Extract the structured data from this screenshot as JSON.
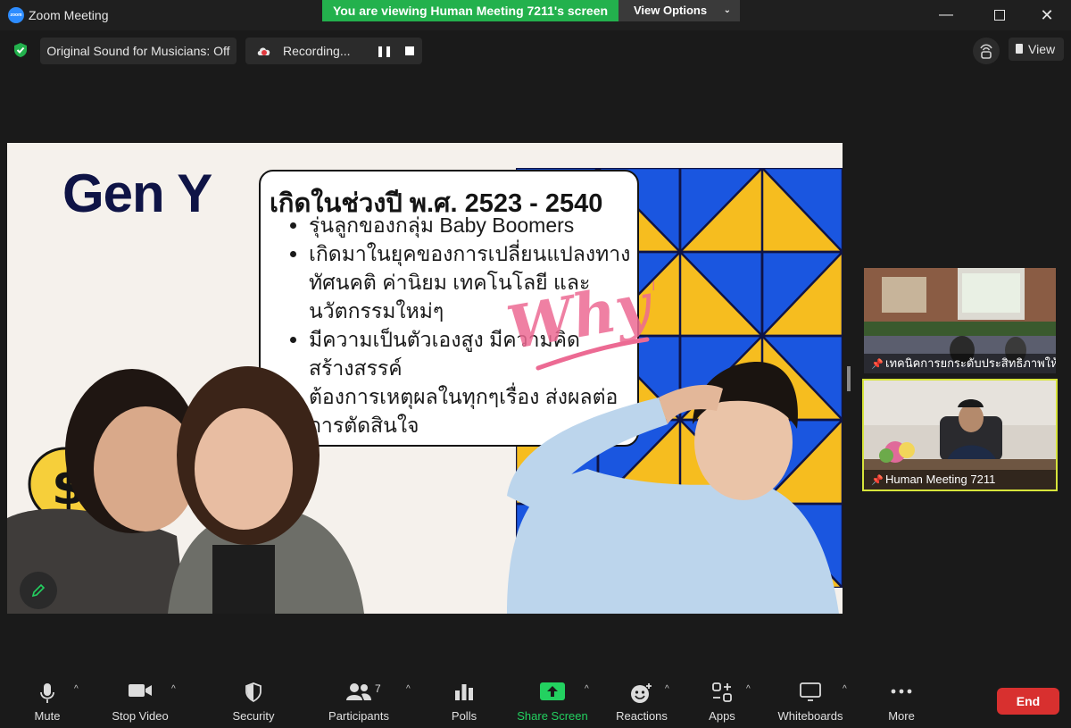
{
  "window": {
    "title": "Zoom Meeting",
    "logo_text": "zoom",
    "minimize": "—",
    "close": "✕"
  },
  "banner": {
    "viewing_text": "You are viewing Human Meeting 7211's screen",
    "view_options_label": "View Options",
    "view_options_chevron": "⌄"
  },
  "topbar": {
    "original_sound_label": "Original Sound for Musicians: Off",
    "recording_label": "Recording...",
    "pause_glyph": "❚❚",
    "view_label": "View"
  },
  "slide": {
    "title": "Gen Y",
    "heading": "เกิดในช่วงปี พ.ศ. 2523 - 2540",
    "bullets": [
      "รุ่นลูกของกลุ่ม Baby Boomers",
      "เกิดมาในยุคของการเปลี่ยนแปลงทางทัศนคติ ค่านิยม เทคโนโลยี และนวัตกรรมใหม่ๆ",
      "มีความเป็นตัวเองสูง มีความคิดสร้างสรรค์",
      "ต้องการเหตุผลในทุกๆเรื่อง ส่งผลต่อการตัดสินใจ"
    ],
    "why_text": "Why?",
    "colors": {
      "blue": "#1a56e0",
      "yellow": "#f6bd1f",
      "navy": "#0f1446",
      "pink": "#ec6a93"
    }
  },
  "thumbnails": [
    {
      "label": "เทคนิคการยกระดับประสิทธิภาพให้..."
    },
    {
      "label": "Human Meeting 7211"
    }
  ],
  "toolbar": {
    "mute": "Mute",
    "stop_video": "Stop Video",
    "security": "Security",
    "participants": "Participants",
    "participants_count": "7",
    "polls": "Polls",
    "share_screen": "Share Screen",
    "reactions": "Reactions",
    "apps": "Apps",
    "whiteboards": "Whiteboards",
    "more": "More",
    "end": "End",
    "caret": "^"
  }
}
